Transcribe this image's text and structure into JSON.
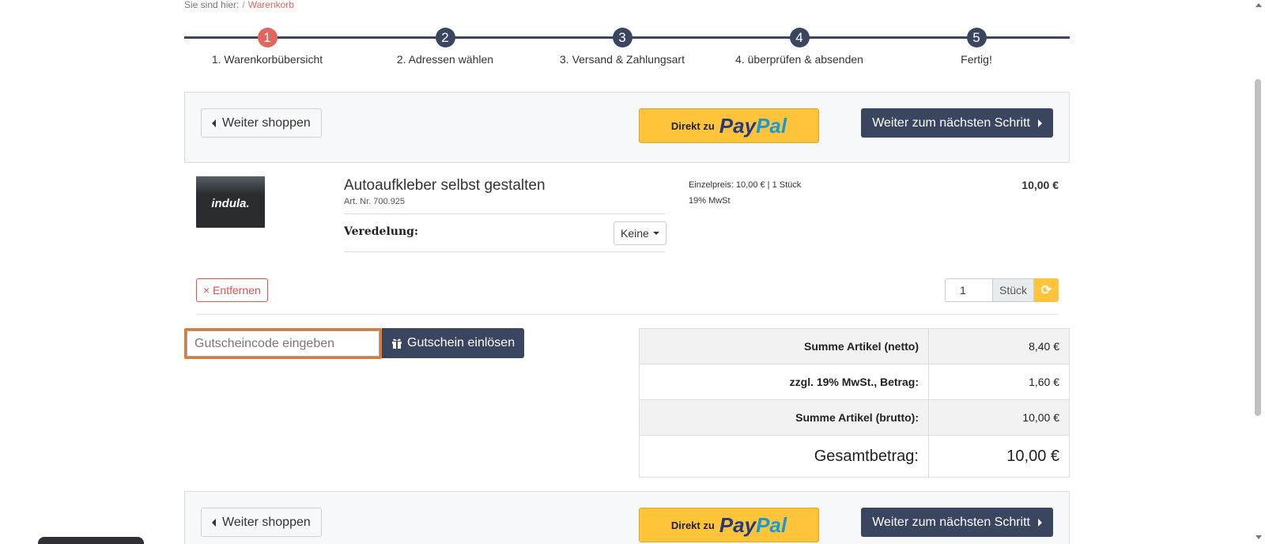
{
  "breadcrumb": {
    "prefix": "Sie sind hier:",
    "separator": "/",
    "current": "Warenkorb"
  },
  "steps": [
    {
      "number": "1",
      "label": "1. Warenkorbübersicht"
    },
    {
      "number": "2",
      "label": "2. Adressen wählen"
    },
    {
      "number": "3",
      "label": "3. Versand & Zahlungsart"
    },
    {
      "number": "4",
      "label": "4. überprüfen & absenden"
    },
    {
      "number": "5",
      "label": "Fertig!"
    }
  ],
  "actions": {
    "back_label": "Weiter shoppen",
    "paypal_prefix": "Direkt zu",
    "paypal_pay": "Pay",
    "paypal_pal": "Pal",
    "next_label": "Weiter zum nächsten Schritt"
  },
  "product": {
    "thumb_text": "indula.",
    "title": "Autoaufkleber selbst gestalten",
    "article": "Art. Nr. 700.925",
    "option_label": "Veredelung:",
    "option_value": "Keine",
    "unit_price": "Einzelpreis: 10,00 € | 1 Stück",
    "vat": "19% MwSt",
    "total": "10,00 €",
    "remove_label": "× Entfernen",
    "quantity": "1",
    "quantity_unit": "Stück"
  },
  "coupon": {
    "placeholder": "Gutscheincode eingeben",
    "button_label": "Gutschein einlösen"
  },
  "totals": [
    {
      "label": "Summe Artikel (netto)",
      "value": "8,40 €"
    },
    {
      "label": "zzgl. 19% MwSt., Betrag:",
      "value": "1,60 €"
    },
    {
      "label": "Summe Artikel (brutto):",
      "value": "10,00 €"
    },
    {
      "label": "Gesamtbetrag:",
      "value": "10,00 €"
    }
  ],
  "colors": {
    "primary": "#3a4560",
    "accent": "#e2665f",
    "paypal": "#ffc439",
    "danger": "#d9534f"
  }
}
